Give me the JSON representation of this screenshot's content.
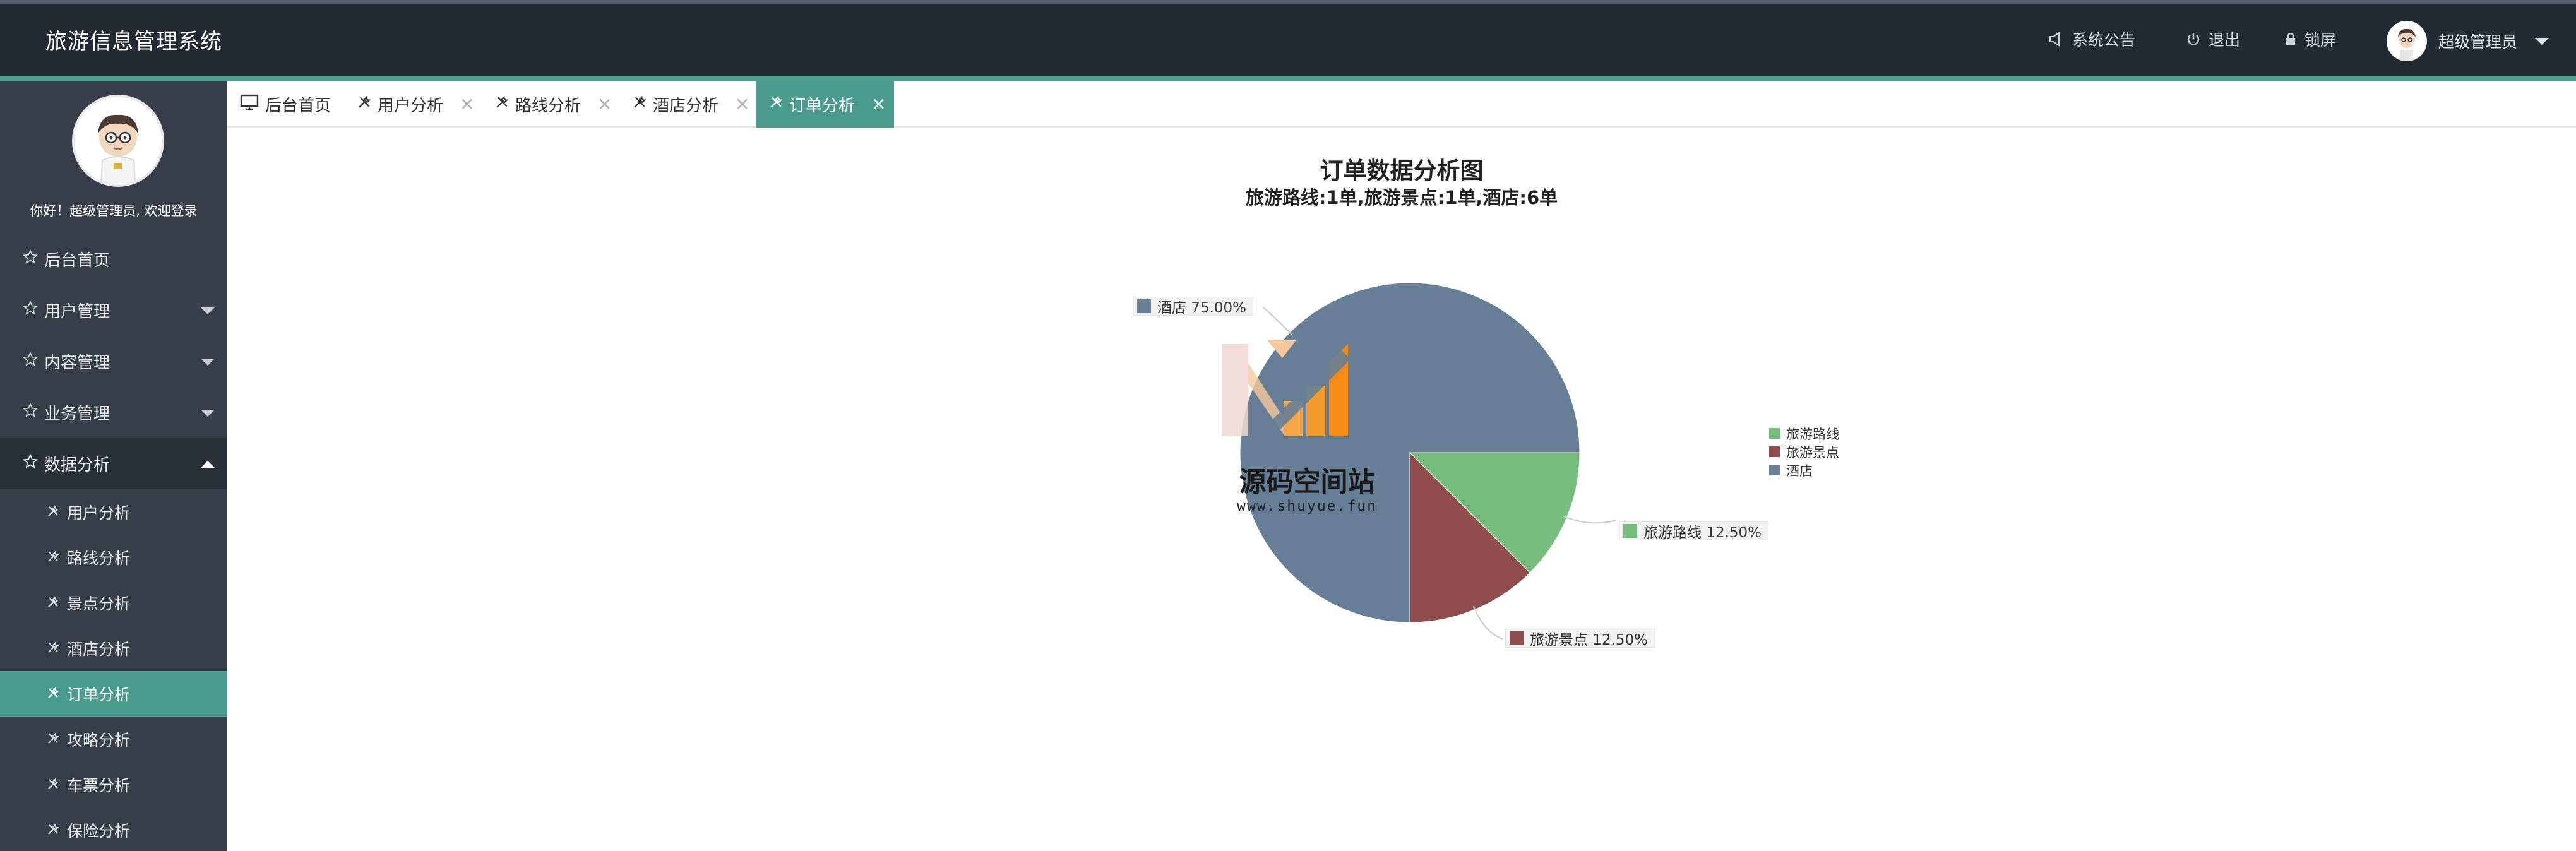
{
  "app": {
    "title": "旅游信息管理系统"
  },
  "header": {
    "notice_label": "系统公告",
    "logout_label": "退出",
    "lock_label": "锁屏",
    "user_label": "超级管理员"
  },
  "sidebar": {
    "welcome": "你好！超级管理员, 欢迎登录",
    "items": [
      {
        "label": "后台首页"
      },
      {
        "label": "用户管理"
      },
      {
        "label": "内容管理"
      },
      {
        "label": "业务管理"
      },
      {
        "label": "数据分析"
      }
    ],
    "sub_items": [
      {
        "label": "用户分析"
      },
      {
        "label": "路线分析"
      },
      {
        "label": "景点分析"
      },
      {
        "label": "酒店分析"
      },
      {
        "label": "订单分析"
      },
      {
        "label": "攻略分析"
      },
      {
        "label": "车票分析"
      },
      {
        "label": "保险分析"
      }
    ],
    "active_sub": "订单分析"
  },
  "tabs": [
    {
      "label": "后台首页"
    },
    {
      "label": "用户分析"
    },
    {
      "label": "路线分析"
    },
    {
      "label": "酒店分析"
    },
    {
      "label": "订单分析"
    }
  ],
  "colors": {
    "sidebar_bg": "#393d49",
    "header_bg": "#242a33",
    "accent": "#4a9a8d"
  },
  "watermark": {
    "text": "源码空间站",
    "url": "www.shuyue.fun"
  },
  "chart_data": {
    "type": "pie",
    "title": "订单数据分析图",
    "subtitle": "旅游路线:1单,旅游景点:1单,酒店:6单",
    "legend_position": "right",
    "slices": [
      {
        "name": "旅游路线",
        "value": 1,
        "percent": "12.50%",
        "color": "#77bd7d"
      },
      {
        "name": "旅游景点",
        "value": 1,
        "percent": "12.50%",
        "color": "#8f4c4c"
      },
      {
        "name": "酒店",
        "value": 6,
        "percent": "75.00%",
        "color": "#667f96"
      }
    ]
  }
}
